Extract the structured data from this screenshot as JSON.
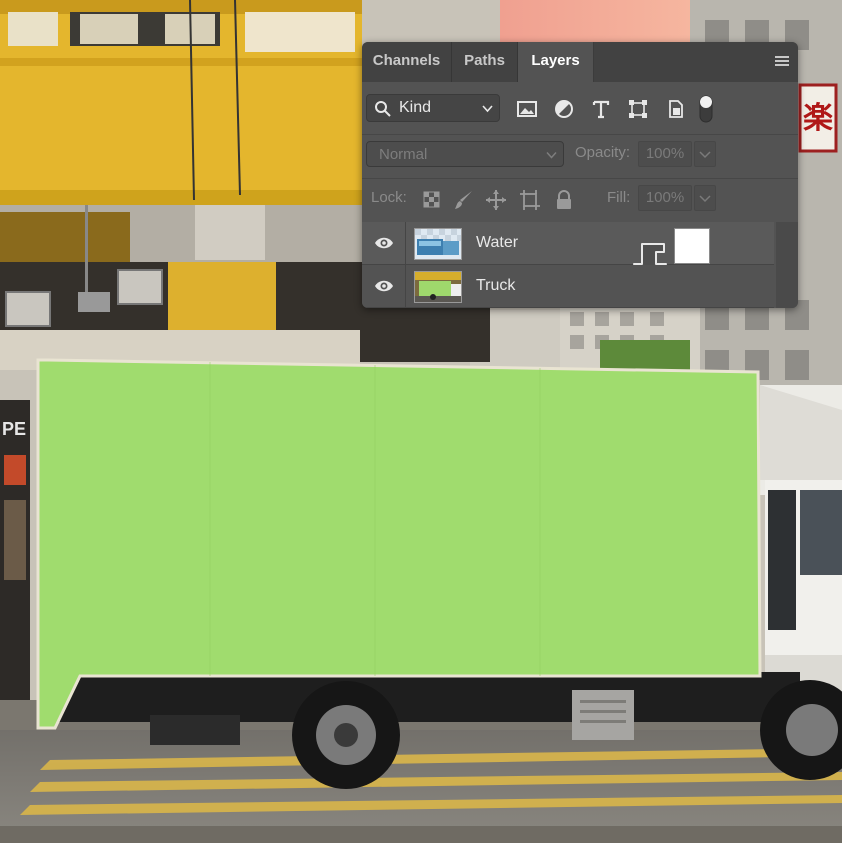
{
  "panel": {
    "tabs": [
      {
        "label": "Channels",
        "active": false
      },
      {
        "label": "Paths",
        "active": false
      },
      {
        "label": "Layers",
        "active": true
      }
    ],
    "menu_icon": "hamburger-menu-icon",
    "filter": {
      "kind_label": "Kind",
      "search_icon": "search-icon",
      "filter_icons": [
        "image-filter-icon",
        "adjustment-filter-icon",
        "type-filter-icon",
        "shape-filter-icon",
        "smart-object-filter-icon",
        "filter-toggle-icon"
      ]
    },
    "blend": {
      "mode": "Normal",
      "opacity_label": "Opacity:",
      "opacity_value": "100%"
    },
    "lock": {
      "label": "Lock:",
      "icons": [
        "lock-transparent-pixels-icon",
        "lock-image-pixels-icon",
        "lock-position-icon",
        "lock-artboard-icon",
        "lock-all-icon"
      ],
      "fill_label": "Fill:",
      "fill_value": "100%"
    },
    "layers": [
      {
        "name": "Water",
        "visible": true,
        "selected": true
      },
      {
        "name": "Truck",
        "visible": true,
        "selected": false
      }
    ]
  },
  "colors": {
    "panel_bg": "#535353",
    "tabbar_bg": "#424242",
    "selection_fill": "#a0dc6e"
  }
}
